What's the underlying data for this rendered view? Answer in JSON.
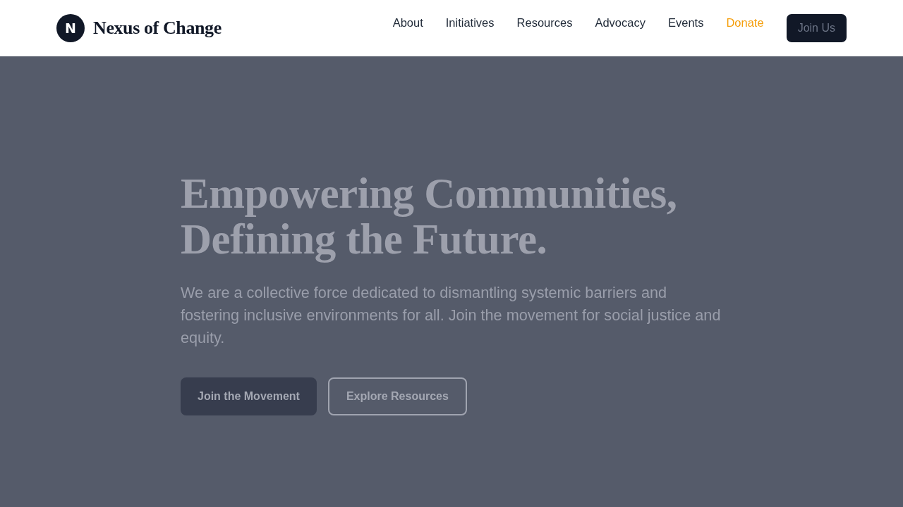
{
  "header": {
    "logo_letter": "N",
    "brand": "Nexus of Change",
    "nav": [
      {
        "label": "About",
        "kind": "link"
      },
      {
        "label": "Initiatives",
        "kind": "link"
      },
      {
        "label": "Resources",
        "kind": "link"
      },
      {
        "label": "Advocacy",
        "kind": "link"
      },
      {
        "label": "Events",
        "kind": "link"
      },
      {
        "label": "Donate",
        "kind": "highlight"
      }
    ],
    "cta": "Join Us"
  },
  "hero": {
    "heading_lines": [
      "Empowering Communities,",
      "Defining the Future."
    ],
    "text": "We are a collective force dedicated to dismantling systemic barriers and fostering inclusive environments for all. Join the movement for social justice and equity.",
    "buttons": [
      {
        "label": "Join the Movement",
        "kind": "primary"
      },
      {
        "label": "Explore Resources",
        "kind": "outline"
      }
    ]
  }
}
